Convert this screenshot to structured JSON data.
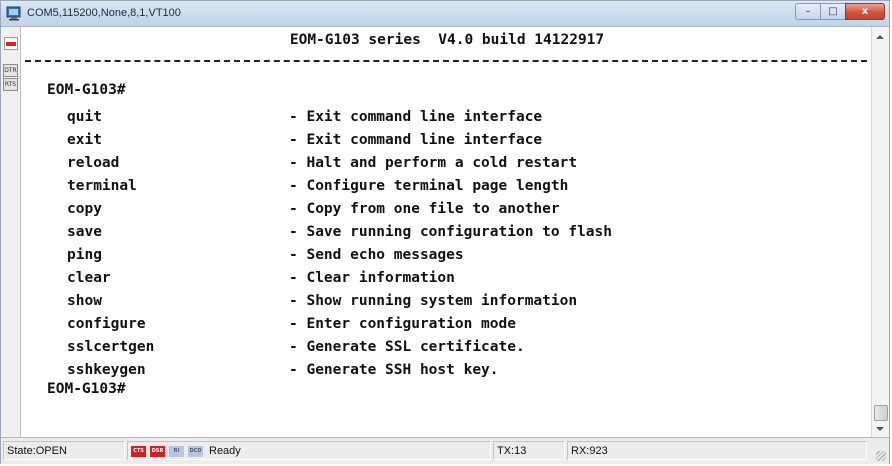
{
  "window": {
    "title": "COM5,115200,None,8,1,VT100"
  },
  "caption_buttons": {
    "minimize": "–",
    "maximize": "□",
    "close": "x"
  },
  "signals": {
    "dtr": "DTR",
    "rts": "RTS"
  },
  "terminal": {
    "header": "EOM-G103 series  V4.0 build 14122917",
    "prompt": "EOM-G103#",
    "commands": [
      {
        "name": "quit",
        "desc": "- Exit command line interface"
      },
      {
        "name": "exit",
        "desc": "- Exit command line interface"
      },
      {
        "name": "reload",
        "desc": "- Halt and perform a cold restart"
      },
      {
        "name": "terminal",
        "desc": "- Configure terminal page length"
      },
      {
        "name": "copy",
        "desc": "- Copy from one file to another"
      },
      {
        "name": "save",
        "desc": "- Save running configuration to flash"
      },
      {
        "name": "ping",
        "desc": "- Send echo messages"
      },
      {
        "name": "clear",
        "desc": "- Clear information"
      },
      {
        "name": "show",
        "desc": "- Show running system information"
      },
      {
        "name": "configure",
        "desc": "- Enter configuration mode"
      },
      {
        "name": "sslcertgen",
        "desc": "- Generate SSL certificate."
      },
      {
        "name": "sshkeygen",
        "desc": "- Generate SSH host key."
      }
    ]
  },
  "statusbar": {
    "state": "State:OPEN",
    "leds": [
      {
        "label": "CTS",
        "on": true
      },
      {
        "label": "DSR",
        "on": true
      },
      {
        "label": "RI",
        "on": false
      },
      {
        "label": "DCD",
        "on": false
      }
    ],
    "status": "Ready",
    "tx": "TX:13",
    "rx": "RX:923"
  },
  "colors": {
    "led_on": "#d21f1f",
    "led_off": "#b6c6e2",
    "close_button": "#c2432b"
  }
}
